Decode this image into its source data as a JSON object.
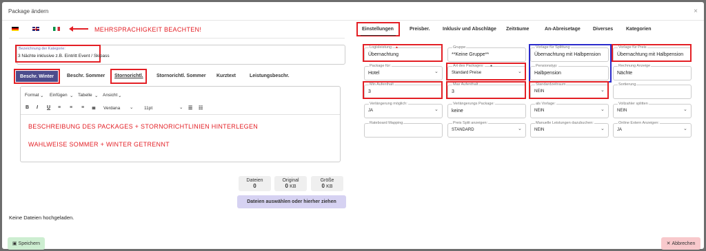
{
  "window": {
    "title": "Package ändern",
    "close_glyph": "×"
  },
  "flags": [
    "german-flag",
    "uk-flag",
    "italian-flag"
  ],
  "annotation_lang": "MEHRSPRACHIGKEIT BEACHTEN!",
  "category": {
    "label": "Bezeichnung der Kategorie:",
    "value": "3 Nächte inklusive z.B. Eintritt Event / Skipass"
  },
  "left_tabs": [
    "Beschr. Winter",
    "Beschr. Sommer",
    "Stornorichtl.",
    "Stornorichtl. Sommer",
    "Kurztext",
    "Leistungsbeschr."
  ],
  "editor": {
    "menu": [
      "Format",
      "Einfügen",
      "Tabelle",
      "Ansicht"
    ],
    "font": "Verdana",
    "size": "11pt",
    "annotation1": "BESCHREIBUNG DES PACKAGES + STORNORICHTLINIEN HINTERLEGEN",
    "annotation2": "WAHLWEISE SOMMER + WINTER GETRENNT"
  },
  "upload": {
    "stats": [
      {
        "label": "Dateien",
        "value": "0"
      },
      {
        "label": "Original",
        "value": "0",
        "unit": "KB"
      },
      {
        "label": "Größe",
        "value": "0",
        "unit": "KB"
      }
    ],
    "button": "Dateien auswählen oder hierher ziehen",
    "empty": "Keine Dateien hochgeladen."
  },
  "right_tabs": [
    "Einstellungen",
    "Preisber.",
    "Inklusiv und Abschläge",
    "Zeiträume",
    "An-Abreisetage",
    "Diverses",
    "Kategorien"
  ],
  "fields": {
    "logisleistung": {
      "label": "Logisleistung",
      "value": "Übernachtung"
    },
    "gruppe": {
      "label": "Gruppe",
      "value": "**Keine Gruppe**"
    },
    "vorlage_splittung": {
      "label": "Vorlage für Splittung",
      "value": "Übernachtung mit Halbpension"
    },
    "vorlage_preis": {
      "label": "Vorlage für Preis",
      "value": "Übernachtung mit Halbpension"
    },
    "package_fuer": {
      "label": "Package für:",
      "value": "Hotel"
    },
    "art_package": {
      "label": "Art des Packages:",
      "value": "Standard Preise"
    },
    "pensionstyp": {
      "label": "Pensionstyp:",
      "value": "Halbpension"
    },
    "rechnung": {
      "label": "Rechnung Anzeige",
      "value": "Nächte"
    },
    "min_aufenthalt": {
      "label": "Min Aufenthalt",
      "value": "3"
    },
    "max_aufenthalt": {
      "label": "Max Aufenthalt",
      "value": "3"
    },
    "standardzeitraum": {
      "label": "Standardzeitraum",
      "value": "NEIN"
    },
    "sortierung": {
      "label": "Sortierung",
      "value": ""
    },
    "verlaengerung": {
      "label": "Verlängerung möglich:",
      "value": "JA"
    },
    "verlaengerungs_pkg": {
      "label": "Verlängerungs Package:",
      "value": "keine"
    },
    "als_vorlage": {
      "label": "als Vorlage:",
      "value": "NEIN"
    },
    "vollzahler": {
      "label": "Vollzahler splitten",
      "value": "NEIN"
    },
    "rateboard": {
      "label": "Rateboard Mapping",
      "value": ""
    },
    "preis_split": {
      "label": "Preis Split anzeigen:",
      "value": "STANDARD"
    },
    "manuelle": {
      "label": "Manuelle Leistungen dazubuchen:",
      "value": "NEIN"
    },
    "online_extern": {
      "label": "Online Extern Anzeigen:",
      "value": "JA"
    }
  },
  "footer": {
    "save": "Speichern",
    "cancel": "Abbrechen"
  }
}
